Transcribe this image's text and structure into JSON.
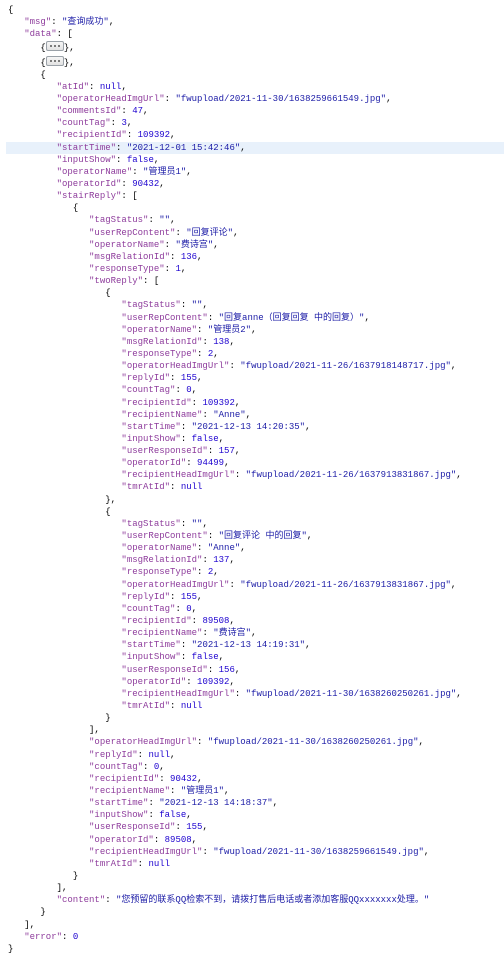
{
  "indent_unit": "   ",
  "root": {
    "msg": "查询成功",
    "data_collapsed": [
      {
        "collapsed": true
      },
      {
        "collapsed": true
      }
    ],
    "record": {
      "atId": null,
      "operatorHeadImgUrl": "fwupload/2021-11-30/1638259661549.jpg",
      "commentsId": 47,
      "countTag": 3,
      "recipientId": 109392,
      "startTime": "2021-12-01 15:42:46",
      "inputShow": false,
      "operatorName": "管理员1",
      "operatorId": 90432,
      "stairReply": [
        {
          "tagStatus": "",
          "userRepContent": "回复评论",
          "operatorName": "费诗宫",
          "msgRelationId": 136,
          "responseType": 1,
          "twoReply": [
            {
              "tagStatus": "",
              "userRepContent": "回复anne（回复回复 中的回复）",
              "operatorName": "管理员2",
              "msgRelationId": 138,
              "responseType": 2,
              "operatorHeadImgUrl": "fwupload/2021-11-26/1637918148717.jpg",
              "replyId": 155,
              "countTag": 0,
              "recipientId": 109392,
              "recipientName": "Anne",
              "startTime": "2021-12-13 14:20:35",
              "inputShow": false,
              "userResponseId": 157,
              "operatorId": 94499,
              "recipientHeadImgUrl": "fwupload/2021-11-26/1637913831867.jpg",
              "tmrAtId": null
            },
            {
              "tagStatus": "",
              "userRepContent": "回复评论 中的回复",
              "operatorName": "Anne",
              "msgRelationId": 137,
              "responseType": 2,
              "operatorHeadImgUrl": "fwupload/2021-11-26/1637913831867.jpg",
              "replyId": 155,
              "countTag": 0,
              "recipientId": 89508,
              "recipientName": "费诗宫",
              "startTime": "2021-12-13 14:19:31",
              "inputShow": false,
              "userResponseId": 156,
              "operatorId": 109392,
              "recipientHeadImgUrl": "fwupload/2021-11-30/1638260250261.jpg",
              "tmrAtId": null
            }
          ],
          "operatorHeadImgUrl": "fwupload/2021-11-30/1638260250261.jpg",
          "replyId": null,
          "countTag": 0,
          "recipientId": 90432,
          "recipientName": "管理员1",
          "startTime": "2021-12-13 14:18:37",
          "inputShow": false,
          "userResponseId": 155,
          "operatorId": 89508,
          "recipientHeadImgUrl": "fwupload/2021-11-30/1638259661549.jpg",
          "tmrAtId": null
        }
      ],
      "content": "您预留的联系QQ检索不到，请拨打售后电话或者添加客服QQxxxxxxx处理。"
    },
    "error": 0
  },
  "highlight_key": "startTime",
  "highlight_value": "2021-12-01 15:42:46"
}
